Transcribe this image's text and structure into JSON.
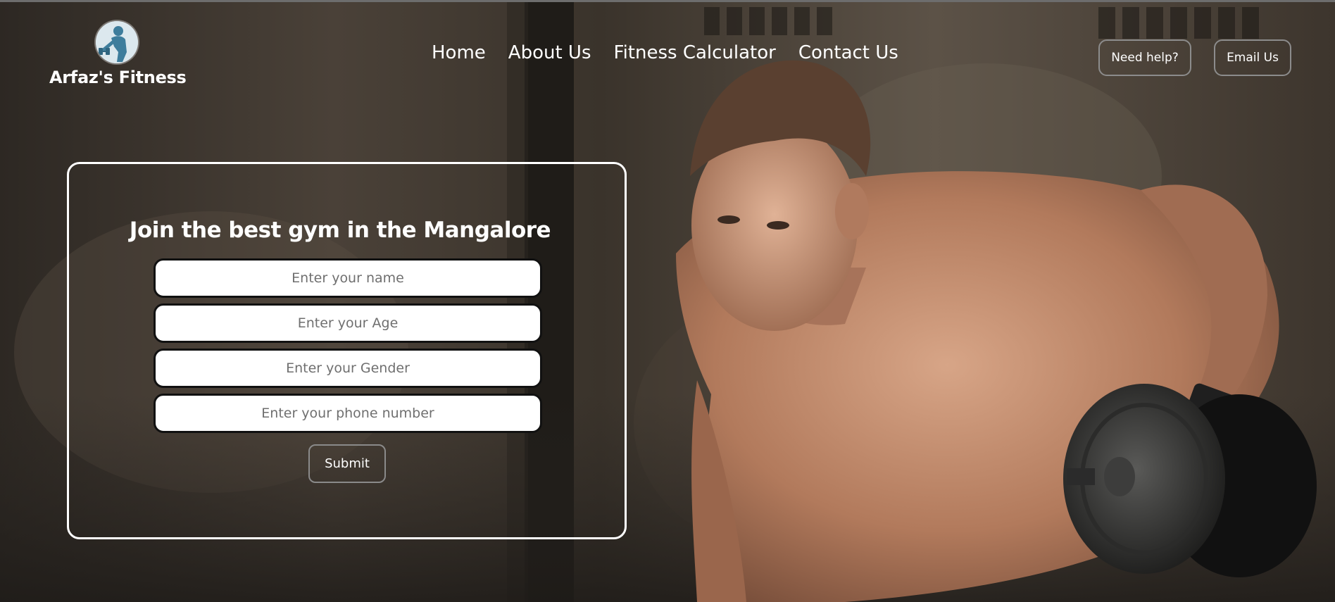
{
  "logo": {
    "name": "Arfaz's Fitness",
    "icon": "weightlifter-avatar-icon"
  },
  "nav": {
    "items": [
      {
        "label": "Home"
      },
      {
        "label": "About Us"
      },
      {
        "label": "Fitness Calculator"
      },
      {
        "label": "Contact Us"
      }
    ]
  },
  "header_actions": {
    "help_label": "Need help?",
    "email_label": "Email Us"
  },
  "join_form": {
    "title": "Join the best gym in the Mangalore",
    "name_placeholder": "Enter your name",
    "age_placeholder": "Enter your Age",
    "gender_placeholder": "Enter your Gender",
    "phone_placeholder": "Enter your phone number",
    "submit_label": "Submit"
  },
  "hero": {
    "image": "man-with-dumbbell-hero-image"
  },
  "colors": {
    "text": "#ffffff",
    "button_border": "#8c8c8c",
    "panel_border": "#ffffff",
    "field_bg": "#ffffff",
    "field_border": "#111111",
    "logo_blue": "#3e7d9c"
  }
}
